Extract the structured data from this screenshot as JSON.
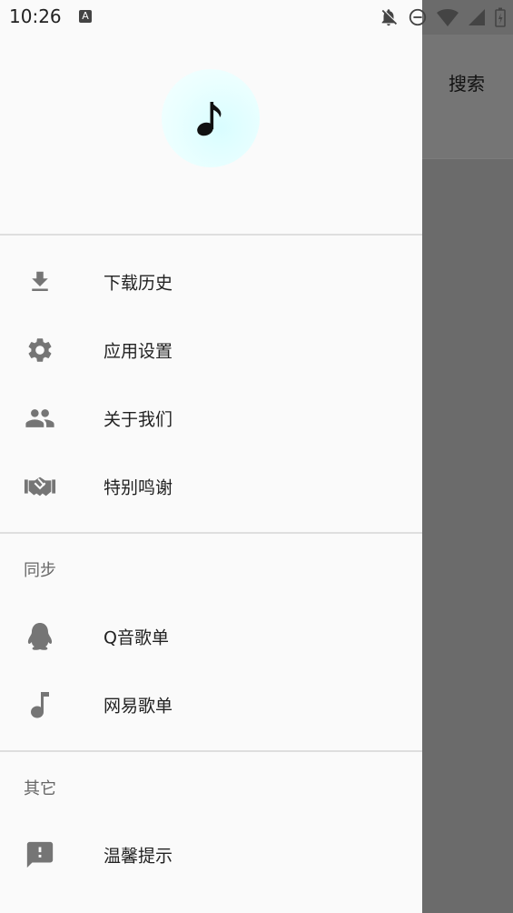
{
  "status_bar": {
    "time": "10:26",
    "notification_letter": "A"
  },
  "background": {
    "search_label": "搜索"
  },
  "drawer": {
    "menu_items": [
      {
        "label": "下载历史",
        "icon": "download-icon"
      },
      {
        "label": "应用设置",
        "icon": "gear-icon"
      },
      {
        "label": "关于我们",
        "icon": "people-icon"
      },
      {
        "label": "特别鸣谢",
        "icon": "handshake-icon"
      }
    ],
    "sync": {
      "title": "同步",
      "items": [
        {
          "label": "Q音歌单",
          "icon": "qq-penguin-icon"
        },
        {
          "label": "网易歌单",
          "icon": "music-note-icon"
        }
      ]
    },
    "other": {
      "title": "其它",
      "items": [
        {
          "label": "温馨提示",
          "icon": "feedback-icon"
        }
      ]
    }
  },
  "colors": {
    "drawer_bg": "#fafafa",
    "scrim": "#6b6b6b",
    "icon": "#757575",
    "text": "#222222",
    "section_title": "#666666",
    "divider": "#dedede"
  }
}
